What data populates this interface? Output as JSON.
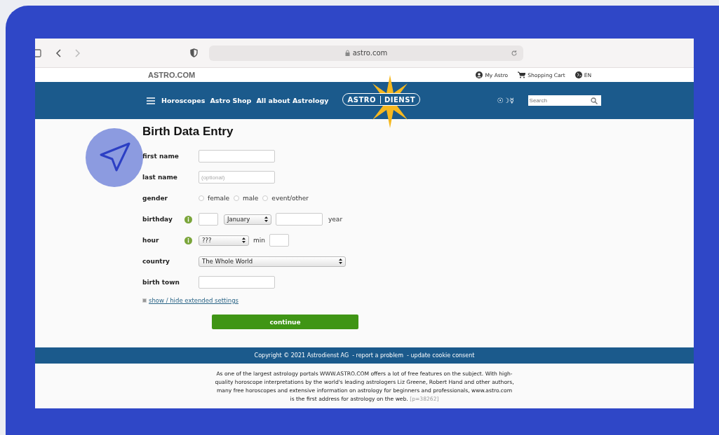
{
  "browser": {
    "address": "astro.com"
  },
  "topbar": {
    "site_name": "ASTRO.COM",
    "links": [
      {
        "kind": "account",
        "label": "My Astro"
      },
      {
        "kind": "cart",
        "label": "Shopping Cart"
      },
      {
        "kind": "language",
        "label": "EN"
      }
    ]
  },
  "nav": {
    "items": [
      "Horoscopes",
      "Astro Shop",
      "All about Astrology"
    ],
    "logo": [
      "ASTRO",
      "DIENST"
    ],
    "symbols": "☉☽☿",
    "search": {
      "placeholder": "Search"
    }
  },
  "form": {
    "title": "Birth Data Entry",
    "first_name": {
      "label": "first name"
    },
    "last_name": {
      "label": "last name",
      "placeholder": "(optional)"
    },
    "gender": {
      "label": "gender",
      "options": [
        {
          "label": "female",
          "selected": false
        },
        {
          "label": "male",
          "selected": false
        },
        {
          "label": "event/other",
          "selected": false
        }
      ]
    },
    "birthday": {
      "label": "birthday",
      "month": "January",
      "year_label": "year"
    },
    "hour": {
      "label": "hour",
      "value": "???",
      "min_label": "min"
    },
    "country": {
      "label": "country",
      "value": "The Whole World"
    },
    "birth_town": {
      "label": "birth town"
    },
    "extended_link": "show / hide extended settings",
    "submit": "continue"
  },
  "footer": {
    "copyright": "Copyright © 2021 Astrodienst AG",
    "links": [
      "- report a problem",
      "- update cookie consent"
    ],
    "about": "As one of the largest astrology portals WWW.ASTRO.COM offers a lot of free features on the subject. With high-quality horoscope interpretations by the world's leading astrologers Liz Greene, Robert Hand and other authors, many free horoscopes and extensive information on astrology for beginners and professionals, www.astro.com is the first address for astrology on the web.",
    "page_id": "[p=38262]"
  }
}
